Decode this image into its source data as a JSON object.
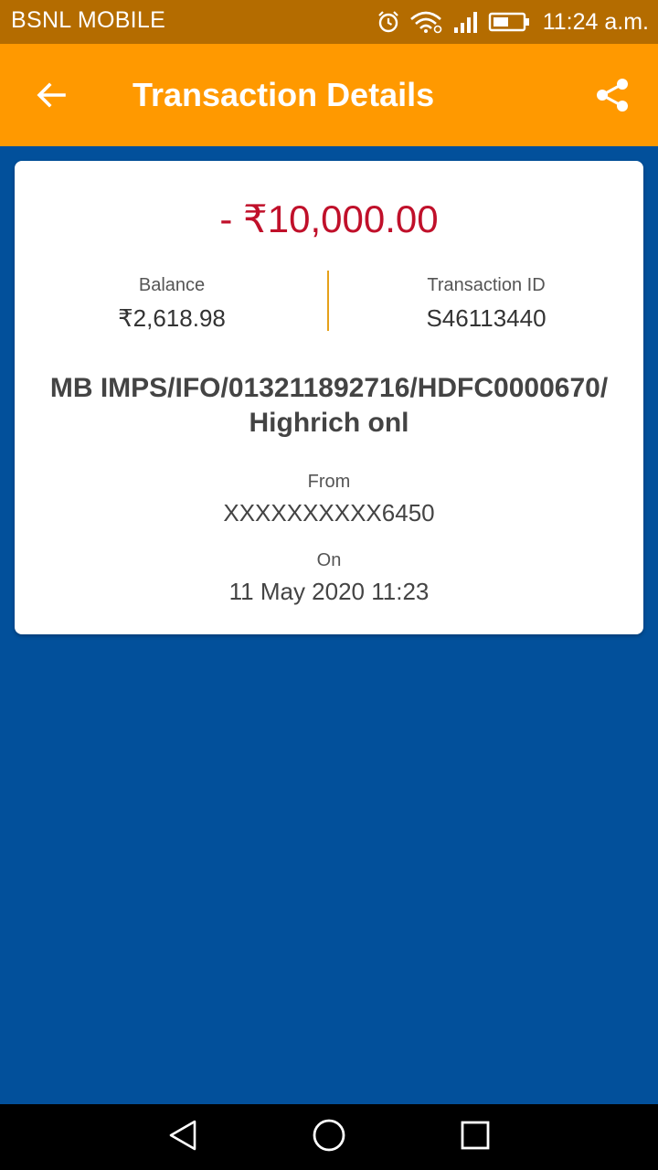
{
  "status_bar": {
    "carrier": "BSNL MOBILE",
    "time": "11:24 a.m.",
    "icons": [
      "alarm-icon",
      "wifi-icon",
      "signal-icon",
      "battery-icon"
    ]
  },
  "app_bar": {
    "title": "Transaction Details",
    "back_icon": "arrow-left-icon",
    "share_icon": "share-icon",
    "background": "#ff9900"
  },
  "transaction": {
    "amount": "- ₹10,000.00",
    "amount_color": "#c0102a",
    "balance_label": "Balance",
    "balance_value": "₹2,618.98",
    "transaction_id_label": "Transaction ID",
    "transaction_id_value": "S46113440",
    "description_line1": "MB IMPS/IFO/013211892716/HDFC0000670/",
    "description_line2": "Highrich onl",
    "from_label": "From",
    "from_value": "XXXXXXXXXX6450",
    "on_label": "On",
    "on_value": "11 May 2020 11:23"
  },
  "nav_bar": {
    "icons": [
      "nav-back-icon",
      "nav-home-icon",
      "nav-recents-icon"
    ]
  },
  "colors": {
    "page_background": "#02509b",
    "status_bar": "#b46c00",
    "divider": "#e6a11a"
  }
}
